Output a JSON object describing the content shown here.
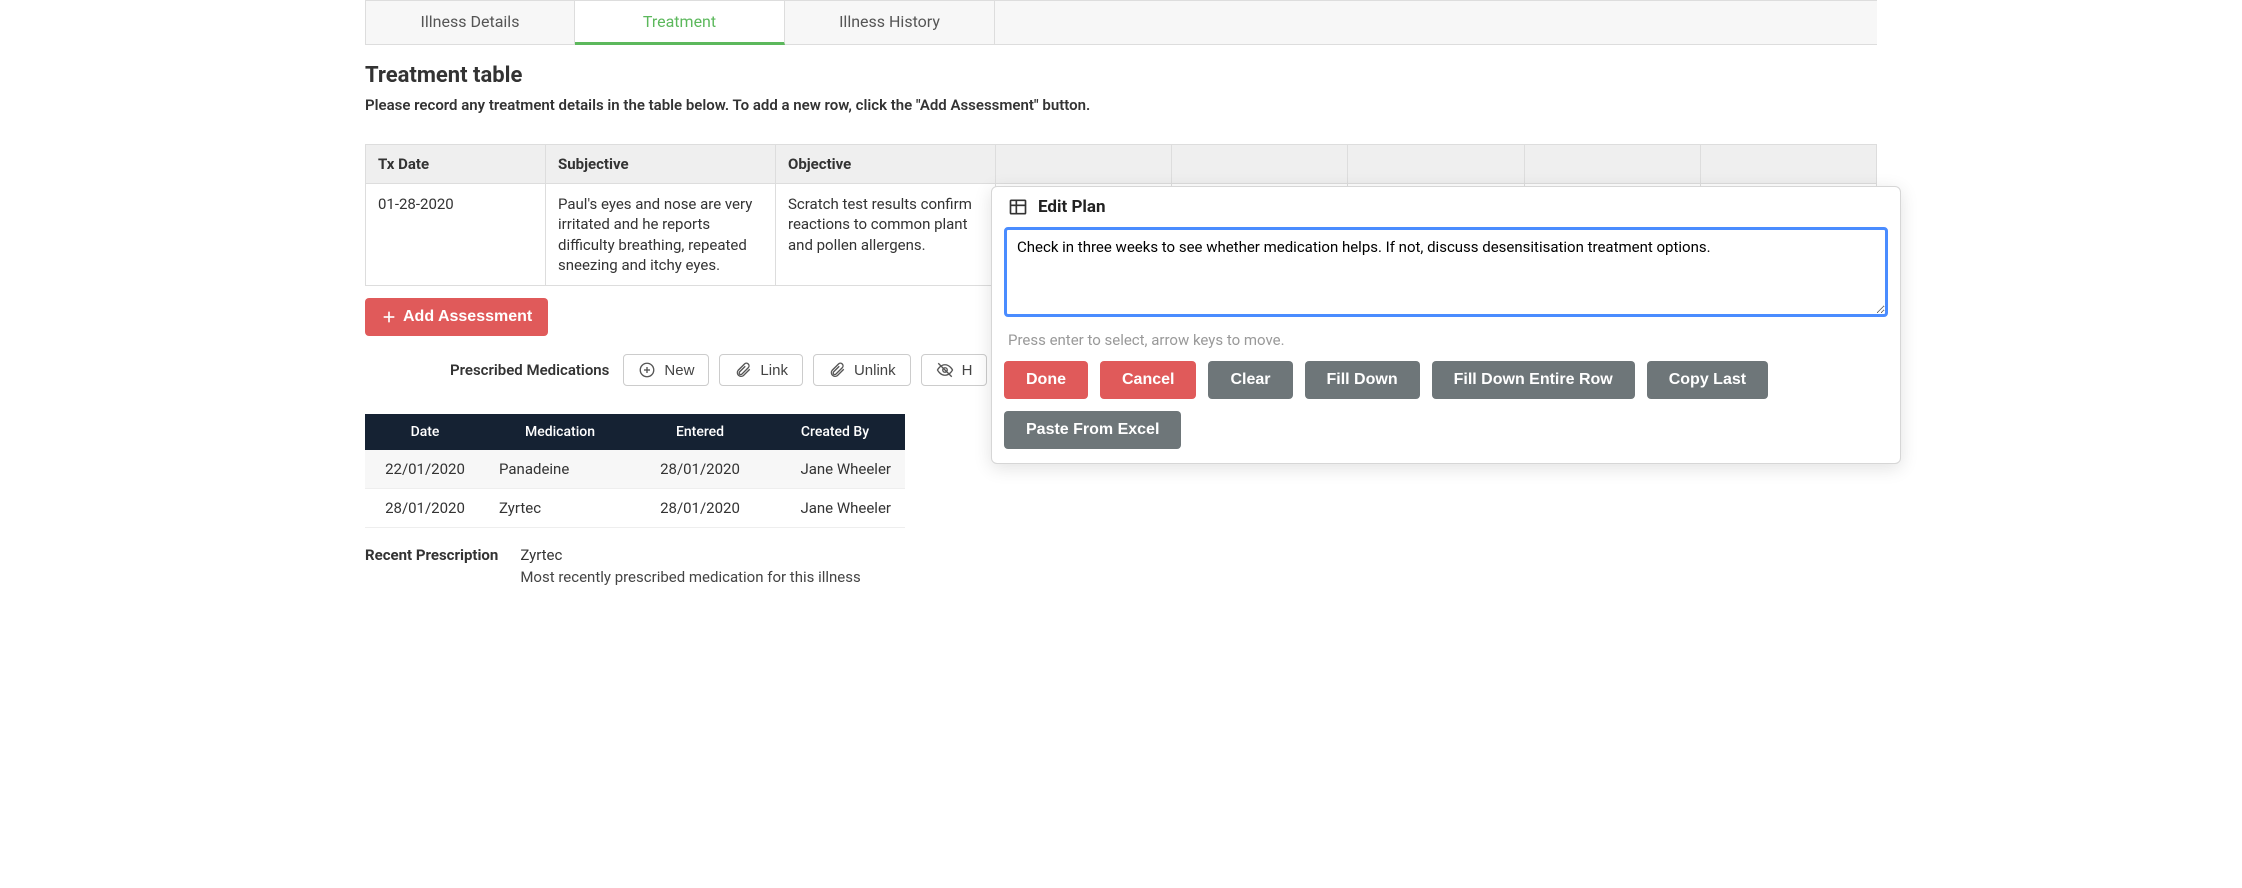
{
  "tabs": {
    "items": [
      {
        "label": "Illness Details",
        "active": false
      },
      {
        "label": "Treatment",
        "active": true
      },
      {
        "label": "Illness History",
        "active": false
      }
    ]
  },
  "page_title": "Treatment table",
  "instructions": "Please record any treatment details in the table below. To add a new row, click the \"Add Assessment\" button.",
  "tx_table": {
    "headers": {
      "date": "Tx Date",
      "subjective": "Subjective",
      "objective": "Objective"
    },
    "rows": [
      {
        "date": "01-28-2020",
        "subjective": "Paul's eyes and nose are very irritated and he reports difficulty breathing, repeated sneezing and itchy eyes.",
        "objective": "Scratch test results confirm reactions to common plant and pollen allergens."
      }
    ]
  },
  "add_assessment_label": "Add Assessment",
  "meds_bar": {
    "label": "Prescribed Medications",
    "buttons": {
      "new": "New",
      "link": "Link",
      "unlink": "Unlink"
    }
  },
  "med_table": {
    "headers": {
      "date": "Date",
      "medication": "Medication",
      "entered": "Entered",
      "created_by": "Created By"
    },
    "rows": [
      {
        "date": "22/01/2020",
        "medication": "Panadeine",
        "entered": "28/01/2020",
        "created_by": "Jane Wheeler"
      },
      {
        "date": "28/01/2020",
        "medication": "Zyrtec",
        "entered": "28/01/2020",
        "created_by": "Jane Wheeler"
      }
    ]
  },
  "recent": {
    "label": "Recent Prescription",
    "value": "Zyrtec",
    "desc": "Most recently prescribed medication for this illness"
  },
  "popover": {
    "title": "Edit Plan",
    "value": "Check in three weeks to see whether medication helps. If not, discuss desensitisation treatment options.",
    "hint": "Press enter to select, arrow keys to move.",
    "buttons": {
      "done": "Done",
      "cancel": "Cancel",
      "clear": "Clear",
      "fill_down": "Fill Down",
      "fill_row": "Fill Down Entire Row",
      "copy_last": "Copy Last",
      "paste_excel": "Paste From Excel"
    }
  }
}
